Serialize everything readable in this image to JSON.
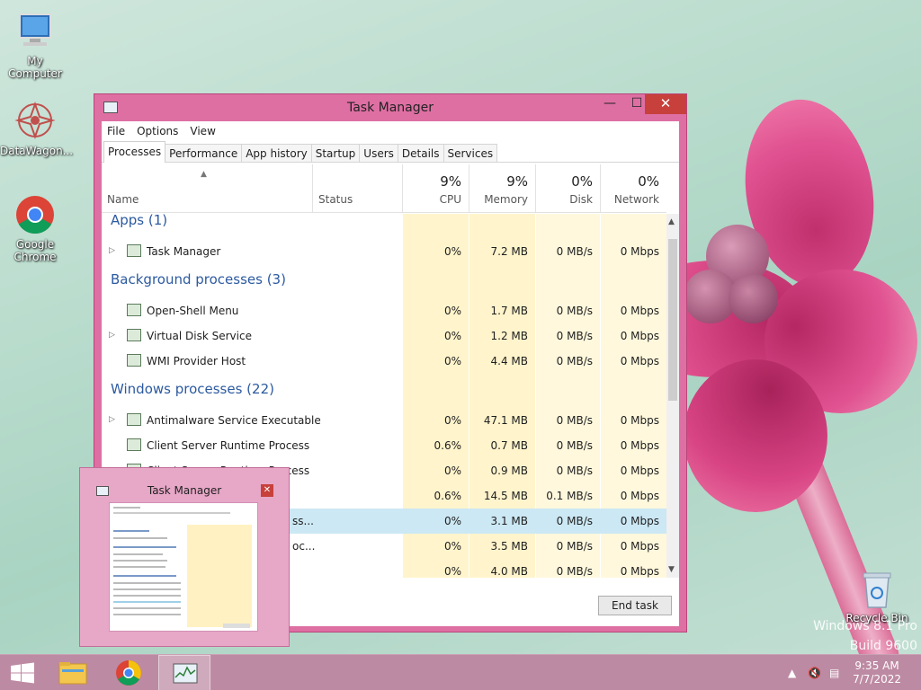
{
  "desktop": {
    "icons": [
      {
        "label": "My Computer"
      },
      {
        "label": "DataWagon..."
      },
      {
        "label": "Google Chrome"
      },
      {
        "label": "Recycle Bin"
      }
    ],
    "watermark": {
      "line1": "Windows 8.1 Pro",
      "line2": "Build 9600"
    }
  },
  "window": {
    "title": "Task Manager",
    "menu": [
      "File",
      "Options",
      "View"
    ],
    "tabs": [
      "Processes",
      "Performance",
      "App history",
      "Startup",
      "Users",
      "Details",
      "Services"
    ],
    "columns": {
      "name": "Name",
      "status": "Status",
      "cpu": {
        "pct": "9%",
        "label": "CPU"
      },
      "memory": {
        "pct": "9%",
        "label": "Memory"
      },
      "disk": {
        "pct": "0%",
        "label": "Disk"
      },
      "network": {
        "pct": "0%",
        "label": "Network"
      }
    },
    "groups": [
      "Apps (1)",
      "Background processes (3)",
      "Windows processes (22)"
    ],
    "rows": [
      {
        "name": "Task Manager",
        "cpu": "0%",
        "mem": "7.2 MB",
        "disk": "0 MB/s",
        "net": "0 Mbps"
      },
      {
        "name": "Open-Shell Menu",
        "cpu": "0%",
        "mem": "1.7 MB",
        "disk": "0 MB/s",
        "net": "0 Mbps"
      },
      {
        "name": "Virtual Disk Service",
        "cpu": "0%",
        "mem": "1.2 MB",
        "disk": "0 MB/s",
        "net": "0 Mbps"
      },
      {
        "name": "WMI Provider Host",
        "cpu": "0%",
        "mem": "4.4 MB",
        "disk": "0 MB/s",
        "net": "0 Mbps"
      },
      {
        "name": "Antimalware Service Executable",
        "cpu": "0%",
        "mem": "47.1 MB",
        "disk": "0 MB/s",
        "net": "0 Mbps"
      },
      {
        "name": "Client Server Runtime Process",
        "cpu": "0.6%",
        "mem": "0.7 MB",
        "disk": "0 MB/s",
        "net": "0 Mbps"
      },
      {
        "name": "Client Server Runtime Process",
        "cpu": "0%",
        "mem": "0.9 MB",
        "disk": "0 MB/s",
        "net": "0 Mbps"
      },
      {
        "name": "",
        "cpu": "0.6%",
        "mem": "14.5 MB",
        "disk": "0.1 MB/s",
        "net": "0 Mbps"
      },
      {
        "name": "ss...",
        "cpu": "0%",
        "mem": "3.1 MB",
        "disk": "0 MB/s",
        "net": "0 Mbps"
      },
      {
        "name": "oc...",
        "cpu": "0%",
        "mem": "3.5 MB",
        "disk": "0 MB/s",
        "net": "0 Mbps"
      },
      {
        "name": "",
        "cpu": "0%",
        "mem": "4.0 MB",
        "disk": "0 MB/s",
        "net": "0 Mbps"
      }
    ],
    "end_task": "End task"
  },
  "preview": {
    "title": "Task Manager",
    "close": "✕"
  },
  "taskbar": {
    "time": "9:35 AM",
    "date": "7/7/2022"
  },
  "colors": {
    "window_frame": "#de6fa3",
    "close": "#c7403b",
    "group_text": "#2c5aa0",
    "highlight": "#fff4cc"
  }
}
